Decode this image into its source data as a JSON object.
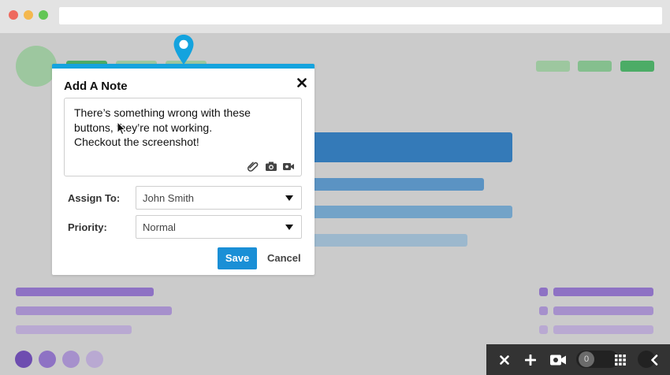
{
  "modal": {
    "title": "Add A Note",
    "close_label": "✕",
    "note_text": "There’s something wrong with these\nbuttons, they’re not working.\nCheckout the screenshot!",
    "assign_label": "Assign To:",
    "assign_value": "John Smith",
    "priority_label": "Priority:",
    "priority_value": "Normal",
    "save_label": "Save",
    "cancel_label": "Cancel"
  },
  "toolbar": {
    "badge_count": "0"
  },
  "colors": {
    "accent": "#14a3de",
    "save_button": "#1a8fd6",
    "toolbar_bg": "#333333"
  },
  "icons": [
    "attachment-icon",
    "camera-icon",
    "video-icon",
    "map-pin-icon",
    "close-icon",
    "plus-icon",
    "grid-icon",
    "chevron-left-icon"
  ]
}
